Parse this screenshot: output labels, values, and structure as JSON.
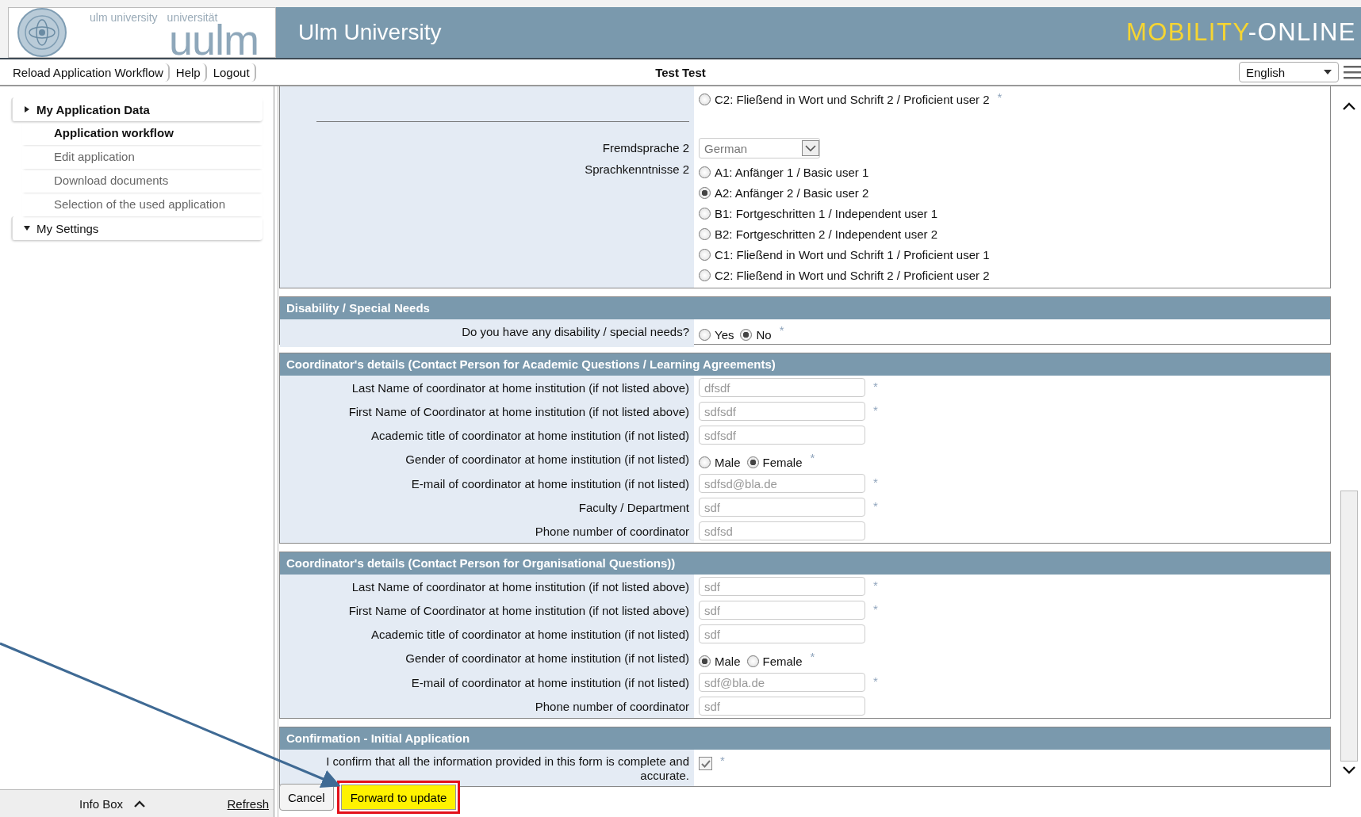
{
  "header": {
    "logo_en": "ulm university",
    "logo_de": "universität",
    "logo_mark": "uulm",
    "title": "Ulm University",
    "brand": [
      "MOBILITY",
      "-ONLINE"
    ]
  },
  "toolbar": {
    "links": [
      "Reload Application Workflow",
      "Help",
      "Logout"
    ],
    "user": "Test Test",
    "language": "English"
  },
  "sidebar": {
    "items": [
      {
        "label": "My Application Data",
        "pointer_down": false,
        "children": [
          {
            "label": "Application workflow",
            "selected": true
          },
          {
            "label": "Edit application",
            "selected": false
          },
          {
            "label": "Download documents",
            "selected": false
          },
          {
            "label": "Selection of the used application",
            "selected": false
          }
        ]
      },
      {
        "label": "My Settings",
        "pointer_down": true
      }
    ]
  },
  "info_box": {
    "label": "Info Box",
    "refresh": "Refresh"
  },
  "form": {
    "sections": [
      {
        "rows": [
          {
            "kind": "radio-list",
            "options": [
              {
                "label": "C2: Fließend in Wort und Schrift 2 / Proficient user 2",
                "selected": false
              }
            ],
            "note": "*"
          },
          {
            "kind": "separator"
          },
          {
            "kind": "select",
            "label": "Fremdsprache 2",
            "value": "German"
          },
          {
            "kind": "radio-list",
            "label": "Sprachkenntnisse 2",
            "options": [
              {
                "label": "A1: Anfänger 1 / Basic user 1",
                "selected": false
              },
              {
                "label": "A2: Anfänger 2 / Basic user 2",
                "selected": true
              },
              {
                "label": "B1: Fortgeschritten 1 / Independent user 1",
                "selected": false
              },
              {
                "label": "B2: Fortgeschritten 2 / Independent user 2",
                "selected": false
              },
              {
                "label": "C1: Fließend in Wort und Schrift 1 / Proficient user 1",
                "selected": false
              },
              {
                "label": "C2: Fließend in Wort und Schrift 2 / Proficient user 2",
                "selected": false
              }
            ]
          }
        ]
      },
      {
        "title": "Disability / Special Needs",
        "rows": [
          {
            "kind": "radio",
            "label": "Do you have any disability / special needs?",
            "options": [
              {
                "label": "Yes",
                "selected": false
              },
              {
                "label": "No",
                "selected": true
              }
            ],
            "note": "*"
          }
        ]
      },
      {
        "title": "Coordinator's details (Contact Person for Academic Questions / Learning Agreements)",
        "rows": [
          {
            "kind": "text",
            "label": "Last Name of coordinator at home institution (if not listed above)",
            "value": "dfsdf",
            "note": "*"
          },
          {
            "kind": "text",
            "label": "First Name of Coordinator at home institution (if not listed above)",
            "value": "sdfsdf",
            "note": "*"
          },
          {
            "kind": "text",
            "label": "Academic title of coordinator at home institution (if not listed)",
            "value": "sdfsdf"
          },
          {
            "kind": "radio",
            "label": "Gender of coordinator at home institution (if not listed)",
            "options": [
              {
                "label": "Male",
                "selected": false
              },
              {
                "label": "Female",
                "selected": true
              }
            ],
            "note": "*"
          },
          {
            "kind": "text",
            "label": "E-mail of coordinator at home institution (if not listed)",
            "value": "sdfsd@bla.de",
            "note": "*"
          },
          {
            "kind": "text",
            "label": "Faculty / Department",
            "value": "sdf",
            "note": "*"
          },
          {
            "kind": "text",
            "label": "Phone number of coordinator",
            "value": "sdfsd"
          }
        ]
      },
      {
        "title": "Coordinator's details (Contact Person for Organisational Questions))",
        "rows": [
          {
            "kind": "text",
            "label": "Last Name of coordinator at home institution (if not listed above)",
            "value": "sdf",
            "note": "*"
          },
          {
            "kind": "text",
            "label": "First Name of Coordinator at home institution (if not listed above)",
            "value": "sdf",
            "note": "*"
          },
          {
            "kind": "text",
            "label": "Academic title of coordinator at home institution (if not listed)",
            "value": "sdf"
          },
          {
            "kind": "radio",
            "label": "Gender of coordinator at home institution (if not listed)",
            "options": [
              {
                "label": "Male",
                "selected": true
              },
              {
                "label": "Female",
                "selected": false
              }
            ],
            "note": "*"
          },
          {
            "kind": "text",
            "label": "E-mail of coordinator at home institution (if not listed)",
            "value": "sdf@bla.de",
            "note": "*"
          },
          {
            "kind": "text",
            "label": "Phone number of coordinator",
            "value": "sdf"
          }
        ]
      },
      {
        "title": "Confirmation - Initial Application",
        "rows": [
          {
            "kind": "checkbox",
            "label": "I confirm that all the information provided in this form is complete and accurate.",
            "checked": true,
            "note": "*"
          }
        ]
      }
    ]
  },
  "buttons": [
    {
      "label": "Cancel",
      "highlighted": false
    },
    {
      "label": "Forward to update",
      "highlighted": true
    }
  ]
}
